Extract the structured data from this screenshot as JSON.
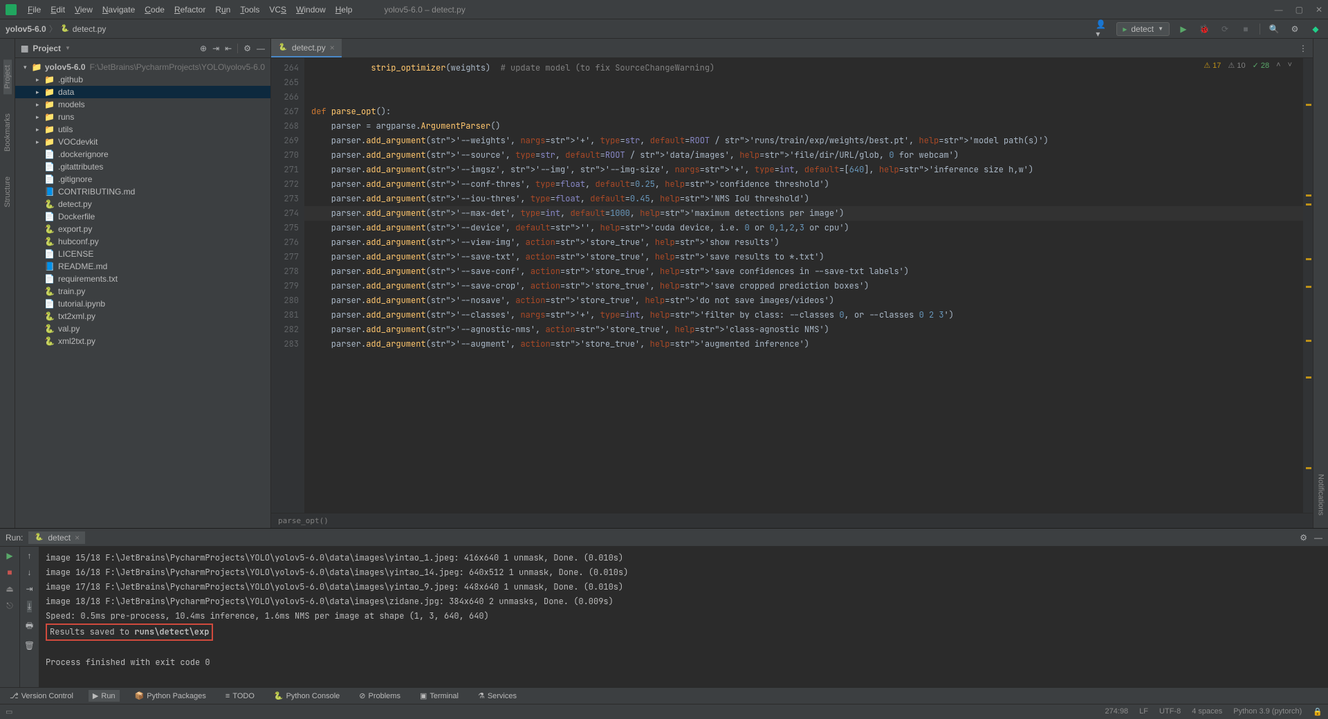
{
  "window": {
    "title": "yolov5-6.0 – detect.py"
  },
  "menu": [
    "File",
    "Edit",
    "View",
    "Navigate",
    "Code",
    "Refactor",
    "Run",
    "Tools",
    "VCS",
    "Window",
    "Help"
  ],
  "breadcrumb": {
    "root": "yolov5-6.0",
    "file": "detect.py"
  },
  "runConfig": {
    "name": "detect"
  },
  "projectPanel": {
    "title": "Project"
  },
  "tree": {
    "root": "yolov5-6.0",
    "rootPath": "F:\\JetBrains\\PycharmProjects\\YOLO\\yolov5-6.0",
    "folders": [
      ".github",
      "data",
      "models",
      "runs",
      "utils",
      "VOCdevkit"
    ],
    "selectedFolder": "data",
    "files": [
      ".dockerignore",
      ".gitattributes",
      ".gitignore",
      "CONTRIBUTING.md",
      "detect.py",
      "Dockerfile",
      "export.py",
      "hubconf.py",
      "LICENSE",
      "README.md",
      "requirements.txt",
      "train.py",
      "tutorial.ipynb",
      "txt2xml.py",
      "val.py",
      "xml2txt.py"
    ]
  },
  "editor": {
    "tabFile": "detect.py",
    "inspections": {
      "warn": "17",
      "weak": "10",
      "ok": "28"
    },
    "firstLine": 264,
    "lines": [
      "            strip_optimizer(weights)  # update model (to fix SourceChangeWarning)",
      "",
      "",
      "def parse_opt():",
      "    parser = argparse.ArgumentParser()",
      "    parser.add_argument('--weights', nargs='+', type=str, default=ROOT / 'runs/train/exp/weights/best.pt', help='model path(s)')",
      "    parser.add_argument('--source', type=str, default=ROOT / 'data/images', help='file/dir/URL/glob, 0 for webcam')",
      "    parser.add_argument('--imgsz', '--img', '--img-size', nargs='+', type=int, default=[640], help='inference size h,w')",
      "    parser.add_argument('--conf-thres', type=float, default=0.25, help='confidence threshold')",
      "    parser.add_argument('--iou-thres', type=float, default=0.45, help='NMS IoU threshold')",
      "    parser.add_argument('--max-det', type=int, default=1000, help='maximum detections per image')",
      "    parser.add_argument('--device', default='', help='cuda device, i.e. 0 or 0,1,2,3 or cpu')",
      "    parser.add_argument('--view-img', action='store_true', help='show results')",
      "    parser.add_argument('--save-txt', action='store_true', help='save results to *.txt')",
      "    parser.add_argument('--save-conf', action='store_true', help='save confidences in --save-txt labels')",
      "    parser.add_argument('--save-crop', action='store_true', help='save cropped prediction boxes')",
      "    parser.add_argument('--nosave', action='store_true', help='do not save images/videos')",
      "    parser.add_argument('--classes', nargs='+', type=int, help='filter by class: --classes 0, or --classes 0 2 3')",
      "    parser.add_argument('--agnostic-nms', action='store_true', help='class-agnostic NMS')",
      "    parser.add_argument('--augment', action='store_true', help='augmented inference')"
    ],
    "highlightedLine": 274,
    "breadcrumbFn": "parse_opt()"
  },
  "runWindow": {
    "label": "Run:",
    "tabName": "detect",
    "lines": [
      "image 15/18 F:\\JetBrains\\PycharmProjects\\YOLO\\yolov5-6.0\\data\\images\\yintao_1.jpeg: 416x640 1 unmask, Done. (0.010s)",
      "image 16/18 F:\\JetBrains\\PycharmProjects\\YOLO\\yolov5-6.0\\data\\images\\yintao_14.jpeg: 640x512 1 unmask, Done. (0.010s)",
      "image 17/18 F:\\JetBrains\\PycharmProjects\\YOLO\\yolov5-6.0\\data\\images\\yintao_9.jpeg: 448x640 1 unmask, Done. (0.010s)",
      "image 18/18 F:\\JetBrains\\PycharmProjects\\YOLO\\yolov5-6.0\\data\\images\\zidane.jpg: 384x640 2 unmasks, Done. (0.009s)",
      "Speed: 0.5ms pre-process, 10.4ms inference, 1.6ms NMS per image at shape (1, 3, 640, 640)"
    ],
    "resultsPrefix": "Results saved to ",
    "resultsPath": "runs\\detect\\exp",
    "exit": "Process finished with exit code 0"
  },
  "bottomTools": [
    "Version Control",
    "Run",
    "Python Packages",
    "TODO",
    "Python Console",
    "Problems",
    "Terminal",
    "Services"
  ],
  "leftTools": [
    "Project",
    "Bookmarks",
    "Structure"
  ],
  "rightTools": [
    "Notifications"
  ],
  "status": {
    "pos": "274:98",
    "sep": "LF",
    "enc": "UTF-8",
    "indent": "4 spaces",
    "python": "Python 3.9 (pytorch)"
  }
}
